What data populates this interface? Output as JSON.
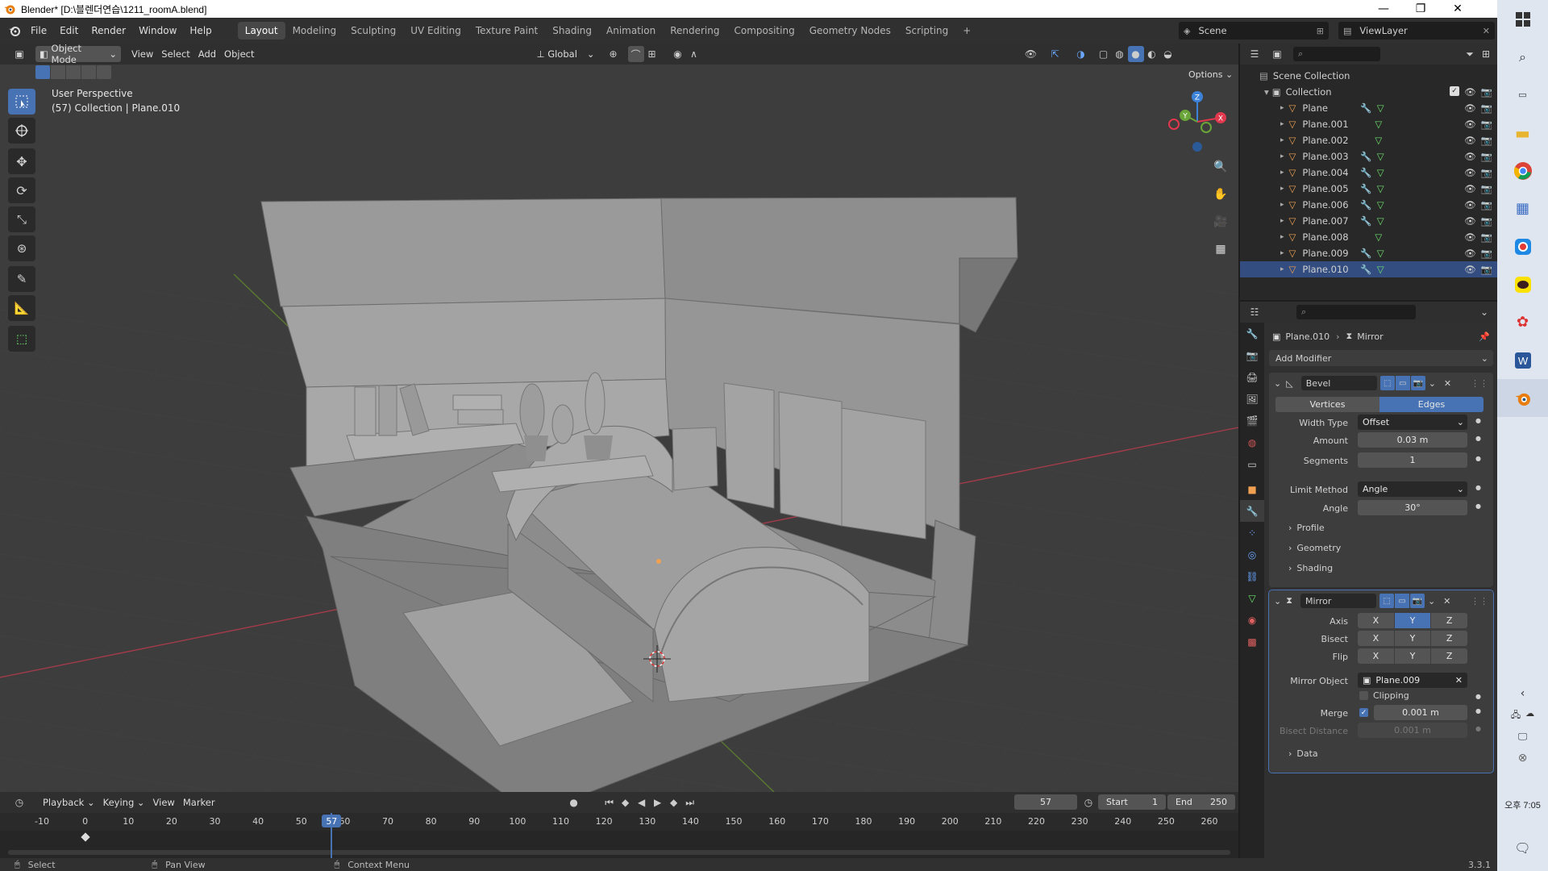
{
  "window": {
    "title": "Blender* [D:\\블렌더연습\\1211_roomA.blend]",
    "controls": [
      "—",
      "❐",
      "✕"
    ]
  },
  "menubar": {
    "menus": [
      "File",
      "Edit",
      "Render",
      "Window",
      "Help"
    ],
    "workspaces": [
      "Layout",
      "Modeling",
      "Sculpting",
      "UV Editing",
      "Texture Paint",
      "Shading",
      "Animation",
      "Rendering",
      "Compositing",
      "Geometry Nodes",
      "Scripting"
    ],
    "active_workspace": "Layout",
    "scene": "Scene",
    "view_layer": "ViewLayer"
  },
  "viewport_header": {
    "mode": "Object Mode",
    "menus": [
      "View",
      "Select",
      "Add",
      "Object"
    ],
    "transform_orientation": "Global",
    "options_label": "Options"
  },
  "viewport": {
    "view_name": "User Perspective",
    "collection_info": "(57) Collection | Plane.010"
  },
  "gizmo": {
    "x": "X",
    "y": "Y",
    "z": "Z",
    "x_color": "#e0384c",
    "y_color": "#6aa539",
    "z_color": "#3b82d8"
  },
  "timeline": {
    "menus": [
      "Playback",
      "Keying",
      "View",
      "Marker"
    ],
    "current_frame": "57",
    "start_label": "Start",
    "start": "1",
    "end_label": "End",
    "end": "250",
    "ticks": [
      "-10",
      "0",
      "10",
      "20",
      "30",
      "40",
      "50",
      "60",
      "70",
      "80",
      "90",
      "100",
      "110",
      "120",
      "130",
      "140",
      "150",
      "160",
      "170",
      "180",
      "190",
      "200",
      "210",
      "220",
      "230",
      "240",
      "250",
      "260"
    ],
    "range_start": -10,
    "range_end": 260,
    "current": 57
  },
  "statusbar": {
    "select": "Select",
    "pan_view": "Pan View",
    "context_menu": "Context Menu",
    "version": "3.3.1"
  },
  "outliner": {
    "scene_collection": "Scene Collection",
    "collection": "Collection",
    "objects": [
      {
        "name": "Plane",
        "has_modifier": true
      },
      {
        "name": "Plane.001",
        "has_modifier": false
      },
      {
        "name": "Plane.002",
        "has_modifier": false
      },
      {
        "name": "Plane.003",
        "has_modifier": true
      },
      {
        "name": "Plane.004",
        "has_modifier": true
      },
      {
        "name": "Plane.005",
        "has_modifier": true
      },
      {
        "name": "Plane.006",
        "has_modifier": true
      },
      {
        "name": "Plane.007",
        "has_modifier": true
      },
      {
        "name": "Plane.008",
        "has_modifier": false
      },
      {
        "name": "Plane.009",
        "has_modifier": true
      },
      {
        "name": "Plane.010",
        "has_modifier": true
      }
    ]
  },
  "properties": {
    "breadcrumb_object": "Plane.010",
    "breadcrumb_modifier": "Mirror",
    "add_modifier": "Add Modifier",
    "bevel": {
      "name": "Bevel",
      "tab_vertices": "Vertices",
      "tab_edges": "Edges",
      "width_type_label": "Width Type",
      "width_type": "Offset",
      "amount_label": "Amount",
      "amount": "0.03 m",
      "segments_label": "Segments",
      "segments": "1",
      "limit_method_label": "Limit Method",
      "limit_method": "Angle",
      "angle_label": "Angle",
      "angle": "30°",
      "sub_profile": "Profile",
      "sub_geometry": "Geometry",
      "sub_shading": "Shading"
    },
    "mirror": {
      "name": "Mirror",
      "axis_label": "Axis",
      "bisect_label": "Bisect",
      "flip_label": "Flip",
      "x": "X",
      "y": "Y",
      "z": "Z",
      "mirror_object_label": "Mirror Object",
      "mirror_object": "Plane.009",
      "clipping_label": "Clipping",
      "merge_label": "Merge",
      "merge": "0.001 m",
      "bisect_distance_label": "Bisect Distance",
      "bisect_distance": "0.001 m",
      "sub_data": "Data"
    }
  },
  "taskbar": {
    "time": "오후 7:05"
  },
  "colors": {
    "accent": "#4772b3",
    "header": "#303030",
    "viewport_bg": "#3d3d3d",
    "active_object": "#f0a050"
  }
}
